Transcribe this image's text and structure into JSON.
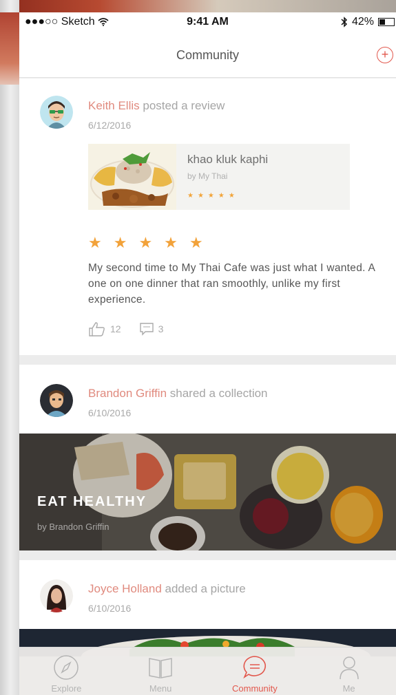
{
  "status_bar": {
    "carrier": "●●●○○ Sketch",
    "time": "9:41 AM",
    "battery": "42%",
    "battery_level": 0.42
  },
  "nav": {
    "title": "Community",
    "add_icon": "plus-circle-icon"
  },
  "feed": [
    {
      "author": "Keith Ellis",
      "action": " posted a review",
      "date": "6/12/2016",
      "dish": {
        "name": "khao kluk kaphi",
        "by": "by My Thai",
        "stars": "★★★★★"
      },
      "rating": "★★★★★",
      "rating_value": 5,
      "review": "My second time to My Thai Cafe was just what I wanted. A one on one dinner that ran smoothly, unlike my first experience.",
      "likes": "12",
      "comments": "3"
    },
    {
      "author": "Brandon Griffin",
      "action": " shared a collection",
      "date": "6/10/2016",
      "collection": {
        "title": "EAT HEALTHY",
        "by": "by Brandon Griffin"
      }
    },
    {
      "author": "Joyce Holland",
      "action": " added a picture",
      "date": "6/10/2016"
    }
  ],
  "tabs": [
    {
      "label": "Explore",
      "icon": "compass-icon",
      "active": false
    },
    {
      "label": "Menu",
      "icon": "book-icon",
      "active": false
    },
    {
      "label": "Community",
      "icon": "chat-bubble-icon",
      "active": true
    },
    {
      "label": "Me",
      "icon": "person-icon",
      "active": false
    }
  ],
  "colors": {
    "accent": "#e2574c",
    "author": "#e08a7e",
    "star": "#f2a23a"
  }
}
